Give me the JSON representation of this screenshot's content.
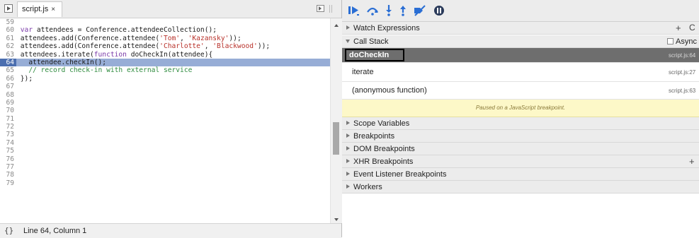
{
  "editor": {
    "tab_label": "script.js",
    "tab_close": "×",
    "lines": [
      {
        "num": "59",
        "parts": []
      },
      {
        "num": "60",
        "parts": [
          {
            "t": "kw",
            "v": "var "
          },
          {
            "t": "txt",
            "v": "attendees = Conference.attendeeCollection();"
          }
        ]
      },
      {
        "num": "61",
        "parts": [
          {
            "t": "txt",
            "v": "attendees.add(Conference.attendee("
          },
          {
            "t": "str",
            "v": "'Tom'"
          },
          {
            "t": "txt",
            "v": ", "
          },
          {
            "t": "str",
            "v": "'Kazansky'"
          },
          {
            "t": "txt",
            "v": "));"
          }
        ]
      },
      {
        "num": "62",
        "parts": [
          {
            "t": "txt",
            "v": "attendees.add(Conference.attendee("
          },
          {
            "t": "str",
            "v": "'Charlotte'"
          },
          {
            "t": "txt",
            "v": ", "
          },
          {
            "t": "str",
            "v": "'Blackwood'"
          },
          {
            "t": "txt",
            "v": "));"
          }
        ]
      },
      {
        "num": "63",
        "parts": [
          {
            "t": "txt",
            "v": "attendees.iterate("
          },
          {
            "t": "kw",
            "v": "function "
          },
          {
            "t": "txt",
            "v": "doCheckIn(attendee){"
          }
        ]
      },
      {
        "num": "64",
        "highlight": true,
        "parts": [
          {
            "t": "txt",
            "v": "  attendee.checkIn();"
          }
        ]
      },
      {
        "num": "65",
        "parts": [
          {
            "t": "cm",
            "v": "  // record check-in with external service"
          }
        ]
      },
      {
        "num": "66",
        "parts": [
          {
            "t": "txt",
            "v": "});"
          }
        ]
      },
      {
        "num": "67",
        "parts": []
      },
      {
        "num": "68",
        "parts": []
      },
      {
        "num": "69",
        "parts": []
      },
      {
        "num": "70",
        "parts": []
      },
      {
        "num": "71",
        "parts": []
      },
      {
        "num": "72",
        "parts": []
      },
      {
        "num": "73",
        "parts": []
      },
      {
        "num": "74",
        "parts": []
      },
      {
        "num": "75",
        "parts": []
      },
      {
        "num": "76",
        "parts": []
      },
      {
        "num": "77",
        "parts": []
      },
      {
        "num": "78",
        "parts": []
      },
      {
        "num": "79",
        "parts": []
      }
    ],
    "status_icon": "{}",
    "status_text": "Line 64, Column 1"
  },
  "debugger": {
    "toolbar_icons": [
      "resume-icon",
      "step-over-icon",
      "step-into-icon",
      "step-out-icon",
      "deactivate-breakpoints-icon",
      "pause-on-exceptions-icon"
    ],
    "watch_label": "Watch Expressions",
    "watch_plus": "+",
    "watch_refresh": "C",
    "callstack_label": "Call Stack",
    "async_label": "Async",
    "frames": [
      {
        "name": "doCheckIn",
        "location": "script.js:64"
      },
      {
        "name": "iterate",
        "location": "script.js:27"
      },
      {
        "name": "(anonymous function)",
        "location": "script.js:63"
      }
    ],
    "paused_message": "Paused on a JavaScript breakpoint.",
    "sections": [
      {
        "label": "Scope Variables"
      },
      {
        "label": "Breakpoints"
      },
      {
        "label": "DOM Breakpoints"
      },
      {
        "label": "XHR Breakpoints",
        "plus": "+"
      },
      {
        "label": "Event Listener Breakpoints"
      },
      {
        "label": "Workers"
      }
    ]
  },
  "colors": {
    "highlight_line": "#97add6",
    "selected_frame": "#6e6e6e",
    "paused_bg": "#fdf8c8",
    "accent_blue": "#2a6ed4"
  }
}
